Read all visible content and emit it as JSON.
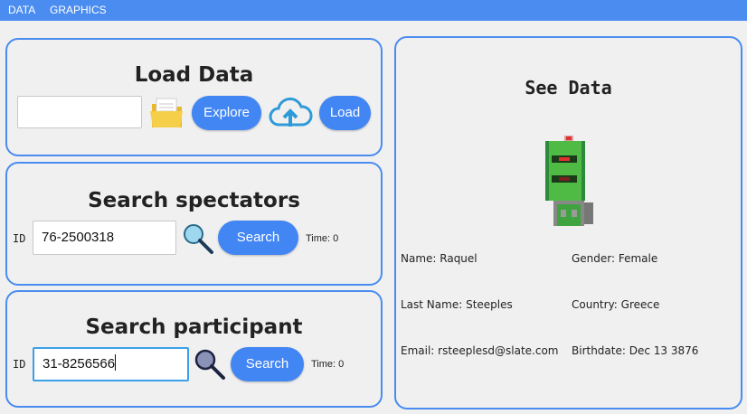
{
  "menu": {
    "items": [
      "DATA",
      "GRAPHICS"
    ]
  },
  "load_panel": {
    "title": "Load Data",
    "path_value": "",
    "explore_label": "Explore",
    "load_label": "Load"
  },
  "spectators_panel": {
    "title": "Search spectators",
    "id_label": "ID",
    "id_value": "76-2500318",
    "search_label": "Search",
    "time_label": "Time: 0"
  },
  "participant_panel": {
    "title": "Search participant",
    "id_label": "ID",
    "id_value": "31-8256566",
    "search_label": "Search",
    "time_label": "Time: 0"
  },
  "see_panel": {
    "title": "See Data",
    "name": "Name: Raquel",
    "last_name": "Last Name: Steeples",
    "email": "Email: rsteeplesd@slate.com",
    "gender": "Gender: Female",
    "country": "Country: Greece",
    "birthdate": "Birthdate: Dec 13 3876"
  },
  "icons": [
    "folder-icon",
    "cloud-upload-icon",
    "magnifier-icon",
    "robot-avatar"
  ],
  "colors": {
    "accent": "#4a8cf0",
    "button": "#4286f4"
  }
}
